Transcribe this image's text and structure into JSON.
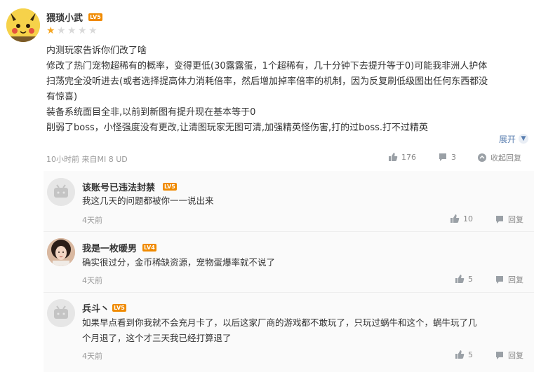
{
  "main_comment": {
    "username": "猥琐小武",
    "level": "LV5",
    "rating": 1,
    "rating_max": 5,
    "lines": [
      "内测玩家告诉你们改了啥",
      "修改了热门宠物超稀有的概率，变得更低(30露露蛋，1个超稀有，几十分钟下去提升等于0)可能我非洲人护体",
      "扫荡完全没听进去(或者选择提高体力消耗倍率，然后增加掉率倍率的机制，因为反复刷低级图出任何东西都没",
      "有惊喜)",
      "装备系统面目全非,以前到新图有提升现在基本等于0",
      "削弱了boss，小怪强度没有更改,让清图玩家无图可清,加强精英怪伤害,打的过boss.打不过精英"
    ],
    "expand_label": "展开",
    "meta": "10小时前  来自MI 8 UD",
    "likes": "176",
    "comments": "3",
    "collapse_reply_label": "收起回复",
    "colors": {
      "accent": "#5b7fb0",
      "star_on": "#f5a623",
      "badge": "#f08a00"
    }
  },
  "replies": [
    {
      "username": "该账号已违法封禁",
      "level": "LV5",
      "avatar_icon": "bilibili-tv-icon",
      "text_lines": [
        "我这几天的问题都被你一一说出来"
      ],
      "time": "4天前",
      "likes": "10",
      "reply_label": "回复"
    },
    {
      "username": "我是一枚暖男",
      "level": "LV4",
      "avatar_icon": "girl-photo-avatar",
      "text_lines": [
        "确实很过分，金币稀缺资源，宠物蛋爆率就不说了"
      ],
      "time": "4天前",
      "likes": "5",
      "reply_label": "回复"
    },
    {
      "username": "兵斗丶",
      "level": "LV5",
      "avatar_icon": "bilibili-tv-icon",
      "text_lines": [
        "如果早点看到你我就不会充月卡了，以后这家厂商的游戏都不敢玩了，只玩过蜗牛和这个，蜗牛玩了几",
        "个月退了，这个才三天我已经打算退了"
      ],
      "time": "4天前",
      "likes": "5",
      "reply_label": "回复"
    }
  ]
}
